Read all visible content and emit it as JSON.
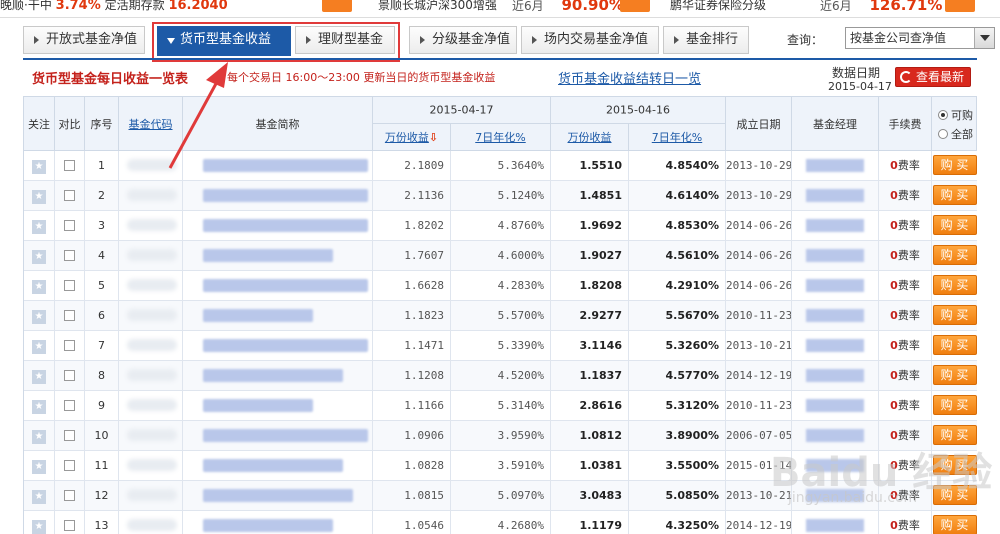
{
  "topbar": {
    "cells": [
      {
        "text": "晚顺·干中",
        "pct": "3.74%",
        "mid": "定活期存款",
        "val": "16.2040"
      },
      {
        "text": "景顺长城沪深300增强",
        "period": "近6月",
        "pct": "90.90%"
      },
      {
        "text": "鹏华证券保险分级",
        "period": "近6月",
        "pct": "126.71%"
      }
    ]
  },
  "tabs": [
    {
      "label": "开放式基金净值",
      "active": false
    },
    {
      "label": "货币型基金收益",
      "active": true
    },
    {
      "label": "理财型基金",
      "active": false
    },
    {
      "label": "分级基金净值",
      "active": false
    },
    {
      "label": "场内交易基金净值",
      "active": false
    },
    {
      "label": "基金排行",
      "active": false
    }
  ],
  "query": {
    "label": "查询：",
    "selected": "按基金公司查净值"
  },
  "panel": {
    "title": "货币型基金每日收益一览表",
    "subtitle": "每个交易日 16:00～23:00 更新当日的货币型基金收益",
    "link": "货币基金收益结转日一览",
    "date_label": "数据日期",
    "date_value": "2015-04-17",
    "refresh_label": "查看最新"
  },
  "table": {
    "headers": {
      "follow": "关注",
      "compare": "对比",
      "index": "序号",
      "code": "基金代码",
      "name": "基金简称",
      "date1": "2015-04-17",
      "date2": "2015-04-16",
      "yield_10k": "万份收益",
      "annual_7d": "7日年化%",
      "yield_10k_2": "万份收益",
      "annual_7d_2": "7日年化%",
      "est_date": "成立日期",
      "manager": "基金经理",
      "fee": "手续费",
      "filter_buyable": "可购",
      "filter_all": "全部"
    },
    "fee_label": "费率",
    "fee_value": "0",
    "buy_label": "购 买",
    "rows": [
      {
        "idx": "1",
        "w1": "2.1809",
        "a1": "5.3640%",
        "w2": "1.5510",
        "a2": "4.8540%",
        "date": "2013-10-29"
      },
      {
        "idx": "2",
        "w1": "2.1136",
        "a1": "5.1240%",
        "w2": "1.4851",
        "a2": "4.6140%",
        "date": "2013-10-29"
      },
      {
        "idx": "3",
        "w1": "1.8202",
        "a1": "4.8760%",
        "w2": "1.9692",
        "a2": "4.8530%",
        "date": "2014-06-26"
      },
      {
        "idx": "4",
        "w1": "1.7607",
        "a1": "4.6000%",
        "w2": "1.9027",
        "a2": "4.5610%",
        "date": "2014-06-26"
      },
      {
        "idx": "5",
        "w1": "1.6628",
        "a1": "4.2830%",
        "w2": "1.8208",
        "a2": "4.2910%",
        "date": "2014-06-26"
      },
      {
        "idx": "6",
        "w1": "1.1823",
        "a1": "5.5700%",
        "w2": "2.9277",
        "a2": "5.5670%",
        "date": "2010-11-23"
      },
      {
        "idx": "7",
        "w1": "1.1471",
        "a1": "5.3390%",
        "w2": "3.1146",
        "a2": "5.3260%",
        "date": "2013-10-21"
      },
      {
        "idx": "8",
        "w1": "1.1208",
        "a1": "4.5200%",
        "w2": "1.1837",
        "a2": "4.5770%",
        "date": "2014-12-19"
      },
      {
        "idx": "9",
        "w1": "1.1166",
        "a1": "5.3140%",
        "w2": "2.8616",
        "a2": "5.3120%",
        "date": "2010-11-23"
      },
      {
        "idx": "10",
        "w1": "1.0906",
        "a1": "3.9590%",
        "w2": "1.0812",
        "a2": "3.8900%",
        "date": "2006-07-05"
      },
      {
        "idx": "11",
        "w1": "1.0828",
        "a1": "3.5910%",
        "w2": "1.0381",
        "a2": "3.5500%",
        "date": "2015-01-14"
      },
      {
        "idx": "12",
        "w1": "1.0815",
        "a1": "5.0970%",
        "w2": "3.0483",
        "a2": "5.0850%",
        "date": "2013-10-21"
      },
      {
        "idx": "13",
        "w1": "1.0546",
        "a1": "4.2680%",
        "w2": "1.1179",
        "a2": "4.3250%",
        "date": "2014-12-19"
      }
    ]
  },
  "watermark": {
    "main": "Baidu 经验",
    "sub": "jingyan.baidu.com"
  },
  "colors": {
    "accent": "#1d5aa7",
    "highlight": "#e03a3a",
    "buy": "#f07f10",
    "title_red": "#c4221c"
  }
}
